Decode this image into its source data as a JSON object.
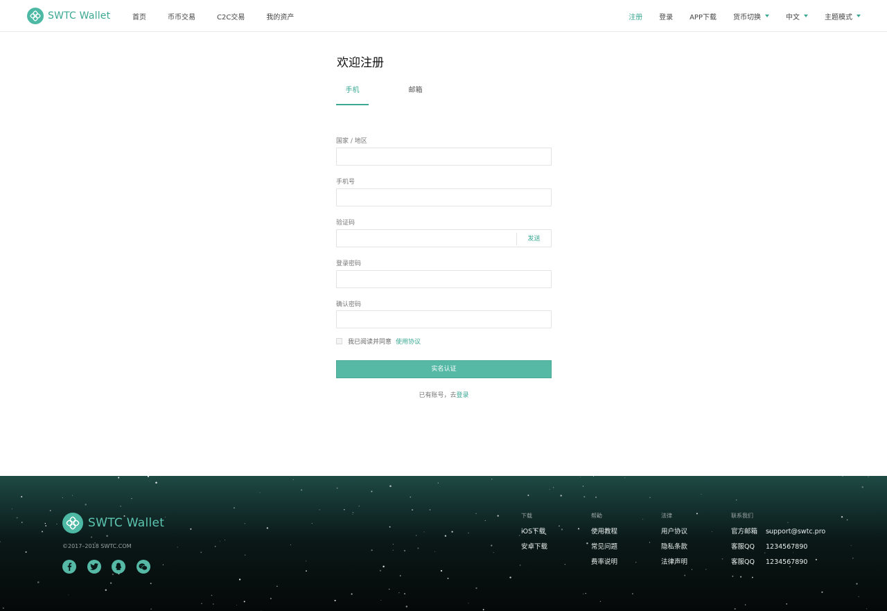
{
  "header": {
    "brand": "SWTC Wallet",
    "nav_left": [
      "首页",
      "币币交易",
      "C2C交易",
      "我的资产"
    ],
    "nav_right": {
      "register": "注册",
      "login": "登录",
      "app_download": "APP下载",
      "currency_switch": "货币切换",
      "language": "中文",
      "theme": "主题模式"
    }
  },
  "form": {
    "title": "欢迎注册",
    "tabs": [
      "手机",
      "邮箱"
    ],
    "active_tab": "手机",
    "fields": {
      "country_label": "国家 / 地区",
      "phone_label": "手机号",
      "code_label": "验证码",
      "send_label": "发送",
      "password_label": "登录密码",
      "confirm_label": "确认密码"
    },
    "agree_text": "我已阅读并同意",
    "agree_link": "使用协议",
    "submit_label": "实名认证",
    "login_hint": "已有账号，去",
    "login_link": "登录"
  },
  "footer": {
    "brand": "SWTC Wallet",
    "copyright": "©2017–2018 SWTC.COM",
    "social_icons": [
      "facebook-icon",
      "twitter-icon",
      "qq-icon",
      "wechat-icon"
    ],
    "columns": {
      "download": {
        "title": "下载",
        "links": [
          "iOS下载",
          "安卓下载"
        ]
      },
      "help": {
        "title": "帮助",
        "links": [
          "使用教程",
          "常见问题",
          "费率说明"
        ]
      },
      "legal": {
        "title": "法律",
        "links": [
          "用户协议",
          "隐私条款",
          "法律声明"
        ]
      },
      "contact": {
        "title": "联系我们",
        "rows": [
          {
            "label": "官方邮箱",
            "value": "support@swtc.pro"
          },
          {
            "label": "客服QQ",
            "value": "1234567890"
          },
          {
            "label": "客服QQ",
            "value": "1234567890"
          }
        ]
      }
    }
  },
  "colors": {
    "accent": "#3aa893",
    "button": "#55b9a6",
    "footer_bg": "#0a1817"
  }
}
